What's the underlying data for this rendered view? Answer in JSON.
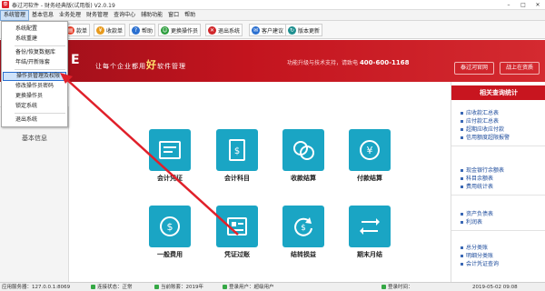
{
  "window": {
    "title": "泰过河软件 - 财务经典版(试用版) V2.0.19",
    "app_icon_glyph": "泰",
    "minimize": "–",
    "maximize": "□",
    "close": "✕"
  },
  "menubar": {
    "items": [
      "系统管理",
      "基本信息",
      "业务处理",
      "财务管理",
      "查询中心",
      "辅助功能",
      "窗口",
      "帮助"
    ]
  },
  "toolbar": {
    "items": [
      {
        "label": "款单",
        "icon": "document-icon",
        "color": "#e8412b"
      },
      {
        "label": "收款单",
        "icon": "money-in-icon",
        "color": "#e89a1c"
      },
      {
        "label": "帮助",
        "icon": "help-icon",
        "color": "#2a6fd0"
      },
      {
        "label": "更换操作员",
        "icon": "user-switch-icon",
        "color": "#2a9c3a"
      },
      {
        "label": "退出系统",
        "icon": "exit-icon",
        "color": "#d0262a"
      },
      {
        "label": "客户建议",
        "icon": "suggest-icon",
        "color": "#2a6fd0"
      },
      {
        "label": "版本更新",
        "icon": "update-icon",
        "color": "#1d8f8f"
      }
    ]
  },
  "banner": {
    "logo": "E",
    "slogan_pre": "让每个企业都用",
    "slogan_big": "好",
    "slogan_post": "软件管理",
    "support_text": "功能升级与技术支持，请致电",
    "phone": "400-600-1168",
    "btn_official": "泰过河官网",
    "btn_help": "战上在资质",
    "color_primary": "#c3141e"
  },
  "left_panel": {
    "header": "基本信息"
  },
  "tiles": [
    {
      "label": "会计凭证",
      "icon": "voucher-icon"
    },
    {
      "label": "会计科目",
      "icon": "ledger-icon"
    },
    {
      "label": "收款结算",
      "icon": "coins-icon"
    },
    {
      "label": "付款结算",
      "icon": "payment-icon"
    },
    {
      "label": "一般费用",
      "icon": "expense-icon"
    },
    {
      "label": "凭证过账",
      "icon": "posting-icon"
    },
    {
      "label": "结转损益",
      "icon": "carryover-icon"
    },
    {
      "label": "期末月结",
      "icon": "month-end-icon"
    }
  ],
  "tile_color": "#1aa5c4",
  "right_panel": {
    "header": "相关查询统计",
    "groups": [
      [
        "应收款汇总表",
        "应付款汇总表",
        "超期应收应付款",
        "信用额度超限报警"
      ],
      [
        "现金银行余额表",
        "科目余额表",
        "费用统计表"
      ],
      [
        "资产负债表",
        "利润表"
      ],
      [
        "总分类账",
        "明细分类账",
        "会计凭证查询"
      ]
    ]
  },
  "dropdown": {
    "items": [
      "系统配置",
      "系统重建",
      "备份/恢复数据库",
      "年结/开新账套",
      "操作员管理及权限",
      "修改操作员密码",
      "更换操作员",
      "锁定系统",
      "退出系统"
    ]
  },
  "statusbar": {
    "server": "应用服务器：127.0.0.1:8069",
    "conn": "连接状态：正常",
    "year": "当前账套：2019年",
    "user": "登录用户：超级用户",
    "login_time": "登录时间：",
    "datetime": "2019-05-02 09:08"
  }
}
